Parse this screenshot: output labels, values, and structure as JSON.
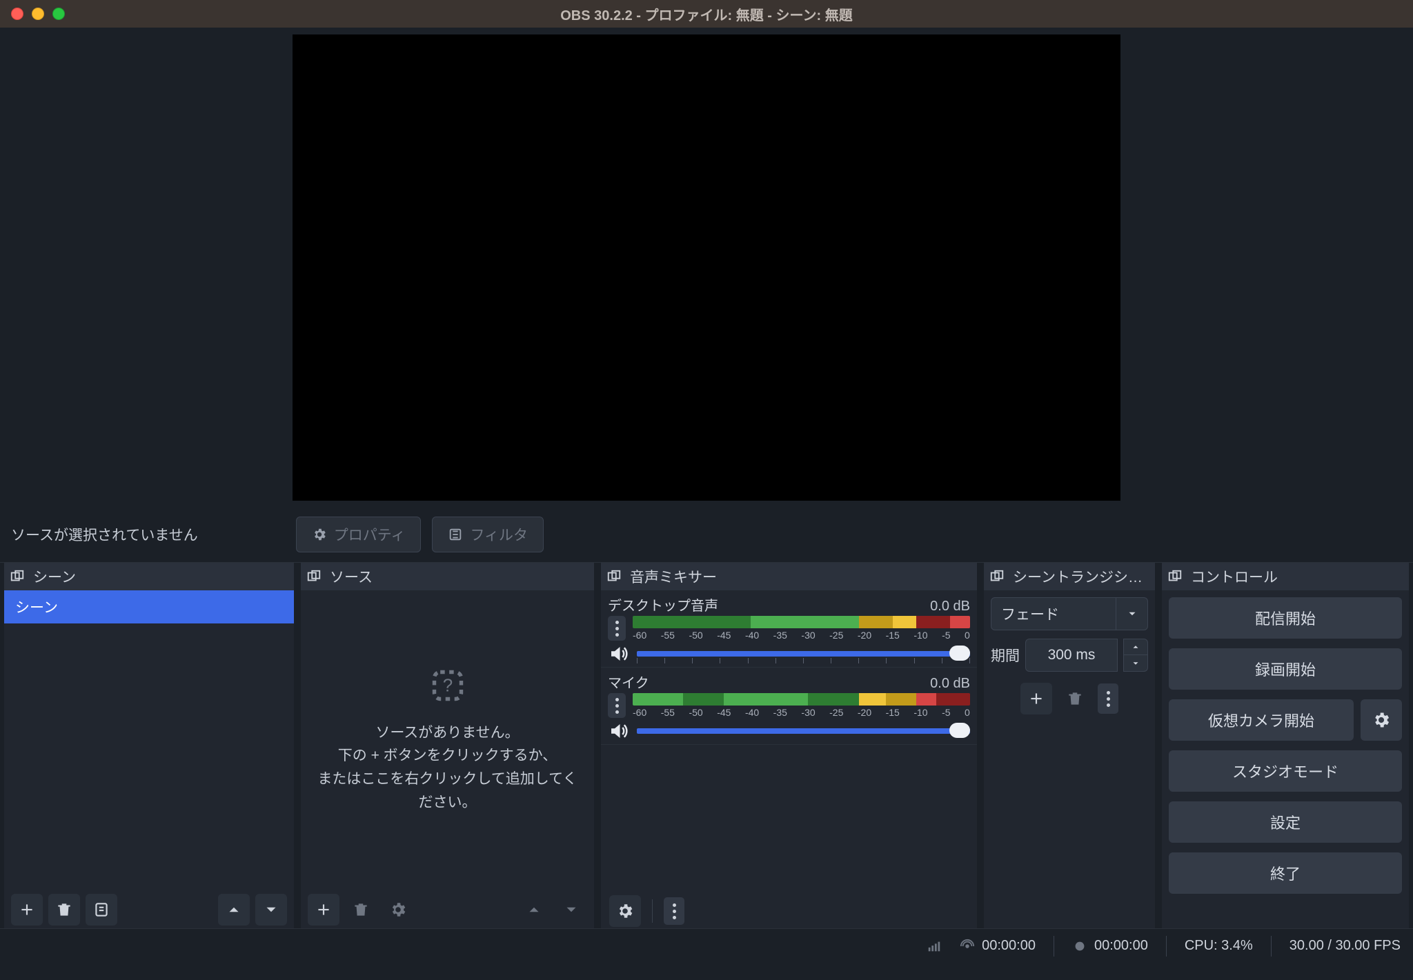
{
  "titlebar": {
    "title": "OBS 30.2.2 - プロファイル: 無題 - シーン: 無題"
  },
  "source_toolbar": {
    "status": "ソースが選択されていません",
    "properties_label": "プロパティ",
    "filters_label": "フィルタ"
  },
  "docks": {
    "scenes": {
      "title": "シーン",
      "items": [
        "シーン"
      ]
    },
    "sources": {
      "title": "ソース",
      "empty_line1": "ソースがありません。",
      "empty_line2": "下の + ボタンをクリックするか、",
      "empty_line3": "またはここを右クリックして追加してく",
      "empty_line4": "ださい。"
    },
    "mixer": {
      "title": "音声ミキサー",
      "ticks": [
        "-60",
        "-55",
        "-50",
        "-45",
        "-40",
        "-35",
        "-30",
        "-25",
        "-20",
        "-15",
        "-10",
        "-5",
        "0"
      ],
      "items": [
        {
          "name": "デスクトップ音声",
          "db": "0.0 dB"
        },
        {
          "name": "マイク",
          "db": "0.0 dB"
        }
      ]
    },
    "transitions": {
      "title": "シーントランジシ…",
      "select_label": "フェード",
      "duration_label": "期間",
      "duration_value": "300 ms"
    },
    "controls": {
      "title": "コントロール",
      "buttons": {
        "stream": "配信開始",
        "record": "録画開始",
        "vcam": "仮想カメラ開始",
        "studio": "スタジオモード",
        "settings": "設定",
        "exit": "終了"
      }
    }
  },
  "statusbar": {
    "live_time": "00:00:00",
    "rec_time": "00:00:00",
    "cpu": "CPU: 3.4%",
    "fps": "30.00 / 30.00 FPS"
  }
}
